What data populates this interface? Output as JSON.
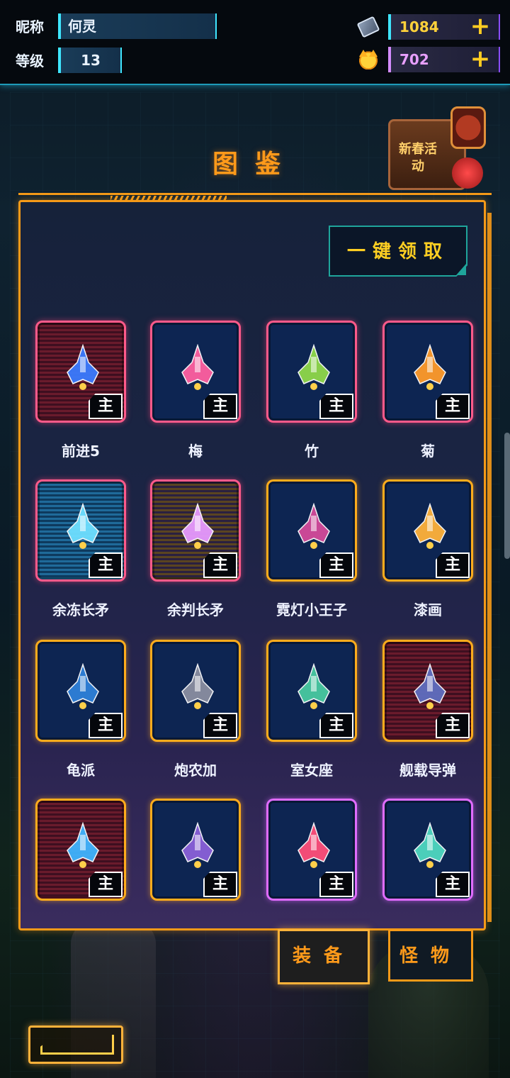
{
  "topbar": {
    "nickname_label": "昵称",
    "nickname": "何灵",
    "level_label": "等级",
    "level": "13",
    "currency_gold": "1084",
    "currency_cat": "702",
    "plus_symbol": "+"
  },
  "title": "图鉴",
  "event": {
    "label": "新春活动"
  },
  "claim_all_label": "一键领取",
  "main_tag": "主",
  "items": [
    {
      "name": "前进5",
      "rarity": "pink",
      "bg": "red-bg",
      "ship_color": "#3a7bff"
    },
    {
      "name": "梅",
      "rarity": "pink",
      "bg": "",
      "ship_color": "#ff5fa0"
    },
    {
      "name": "竹",
      "rarity": "pink",
      "bg": "",
      "ship_color": "#8fd84a"
    },
    {
      "name": "菊",
      "rarity": "pink",
      "bg": "",
      "ship_color": "#ff9a2a"
    },
    {
      "name": "余冻长矛",
      "rarity": "pink",
      "bg": "cyan-bg",
      "ship_color": "#6fe0ff"
    },
    {
      "name": "余判长矛",
      "rarity": "pink",
      "bg": "gold-bg",
      "ship_color": "#e79aff"
    },
    {
      "name": "霓灯小王子",
      "rarity": "gold",
      "bg": "",
      "ship_color": "#d44a9a"
    },
    {
      "name": "漆画",
      "rarity": "gold",
      "bg": "",
      "ship_color": "#ffb23a"
    },
    {
      "name": "龟派",
      "rarity": "gold",
      "bg": "",
      "ship_color": "#2e80d8"
    },
    {
      "name": "炮农加",
      "rarity": "gold",
      "bg": "",
      "ship_color": "#8a8ea0"
    },
    {
      "name": "室女座",
      "rarity": "gold",
      "bg": "",
      "ship_color": "#48c9a0"
    },
    {
      "name": "舰载导弹",
      "rarity": "gold",
      "bg": "red-bg",
      "ship_color": "#5f6ec0"
    },
    {
      "name": "",
      "rarity": "gold",
      "bg": "red-bg",
      "ship_color": "#3fb4ff"
    },
    {
      "name": "",
      "rarity": "gold",
      "bg": "",
      "ship_color": "#8a60d8"
    },
    {
      "name": "",
      "rarity": "violet",
      "bg": "",
      "ship_color": "#ff4f7a"
    },
    {
      "name": "",
      "rarity": "violet",
      "bg": "",
      "ship_color": "#4fd8c0"
    }
  ],
  "tabs": {
    "equipment": "装备",
    "monster": "怪物"
  },
  "colors": {
    "accent_orange": "#f59a18",
    "accent_cyan": "#3fe6ff",
    "gold_text": "#ffcf22"
  }
}
